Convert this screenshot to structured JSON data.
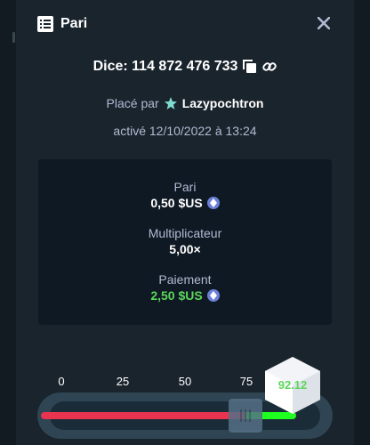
{
  "header": {
    "title": "Pari",
    "icon": "bet-slip-icon"
  },
  "bet": {
    "dice_label": "Dice: 114 872 476 733",
    "placed_by_label": "Placé par",
    "username": "Lazypochtron",
    "activated": "activé 12/10/2022 à 13:24"
  },
  "stats": {
    "pari_label": "Pari",
    "pari_value": "0,50 $US",
    "multiplier_label": "Multiplicateur",
    "multiplier_value": "5,00×",
    "payout_label": "Paiement",
    "payout_value": "2,50 $US"
  },
  "slider": {
    "ticks": [
      "0",
      "25",
      "50",
      "75"
    ],
    "target": 80,
    "result": "92.12"
  },
  "colors": {
    "background": "#1a242d",
    "card": "#0f1923",
    "loss": "#e9334f",
    "win": "#1fff20",
    "payout_text": "#5cd65c",
    "coin": "#6b7fd7"
  }
}
